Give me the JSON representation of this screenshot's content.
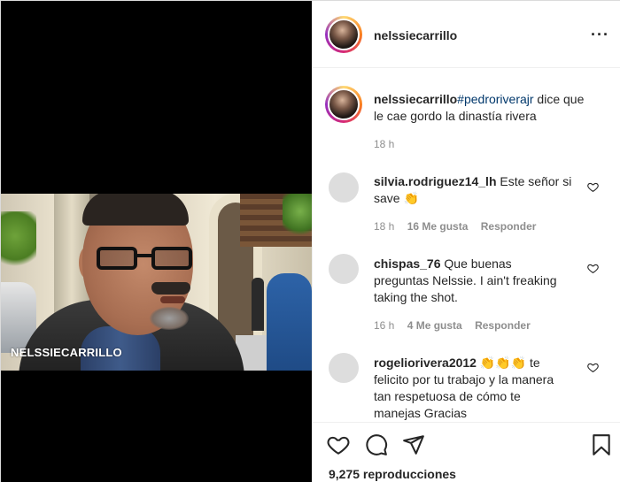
{
  "video": {
    "watermark": "NELSSIECARRILLO"
  },
  "header": {
    "username": "nelssiecarrillo",
    "more_label": "···"
  },
  "caption": {
    "username": "nelssiecarrillo",
    "hashtag": "#pedroriverajr",
    "text_line1": " dice que",
    "text_line2": "le cae gordo la dinastía rivera",
    "time": "18 h"
  },
  "comments": [
    {
      "username": "silvia.rodriguez14_lh",
      "text_line1": " Este señor si",
      "text_line2": "save ",
      "emoji": "👏",
      "time": "18 h",
      "likes": "16 Me gusta",
      "reply": "Responder"
    },
    {
      "username": "chispas_76",
      "text_line1": " Que buenas",
      "text_line2": "preguntas Nelssie. I ain't freaking",
      "text_line3": "taking the shot.",
      "time": "16 h",
      "likes": "4 Me gusta",
      "reply": "Responder"
    },
    {
      "username": "rogeliorivera2012",
      "emoji": " 👏👏👏",
      "text_line1": " te",
      "text_line2": "felicito por tu trabajo y la manera",
      "text_line3": "tan respetuosa de cómo te",
      "text_line4": "manejas Gracias"
    }
  ],
  "footer": {
    "views": "9,275 reproducciones"
  },
  "icons": {
    "like": "heart-icon",
    "comment": "comment-icon",
    "share": "send-icon",
    "save": "bookmark-icon"
  }
}
